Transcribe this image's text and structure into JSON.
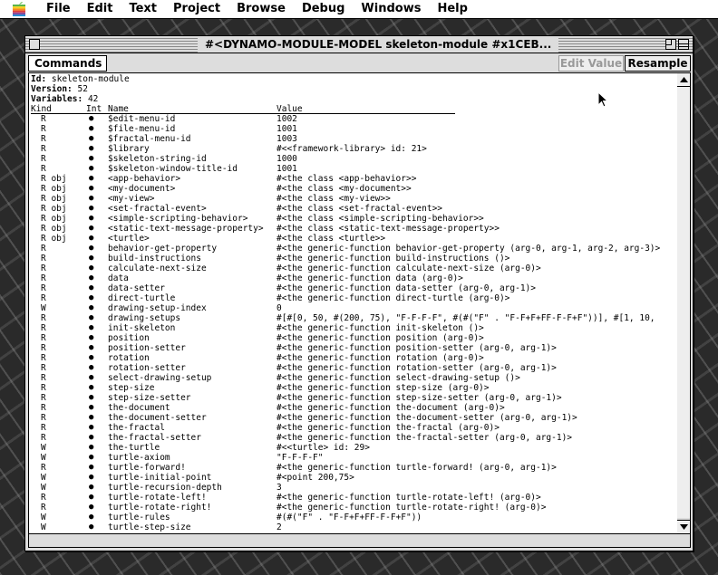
{
  "menubar": {
    "items": [
      "File",
      "Edit",
      "Text",
      "Project",
      "Browse",
      "Debug",
      "Windows",
      "Help"
    ]
  },
  "window": {
    "title": "#<DYNAMO-MODULE-MODEL skeleton-module #x1CEB..."
  },
  "toolbar": {
    "commands_label": "Commands",
    "edit_value_label": "Edit Value",
    "resample_label": "Resample"
  },
  "header": {
    "id_label": "Id:",
    "id_value": "skeleton-module",
    "version_label": "Version:",
    "version_value": "52",
    "variables_label": "Variables:",
    "variables_value": "42"
  },
  "columns": {
    "kind": "Kind",
    "int": "Int",
    "name": "Name",
    "value": "Value"
  },
  "rows": [
    {
      "kind": "R",
      "int": "●",
      "name": "$edit-menu-id",
      "value": "1002"
    },
    {
      "kind": "R",
      "int": "●",
      "name": "$file-menu-id",
      "value": "1001"
    },
    {
      "kind": "R",
      "int": "●",
      "name": "$fractal-menu-id",
      "value": "1003"
    },
    {
      "kind": "R",
      "int": "●",
      "name": "$library",
      "value": "#<<framework-library> id: 21>"
    },
    {
      "kind": "R",
      "int": "●",
      "name": "$skeleton-string-id",
      "value": "1000"
    },
    {
      "kind": "R",
      "int": "●",
      "name": "$skeleton-window-title-id",
      "value": "1001"
    },
    {
      "kind": "R obj",
      "int": "●",
      "name": "<app-behavior>",
      "value": "#<the class <app-behavior>>"
    },
    {
      "kind": "R obj",
      "int": "●",
      "name": "<my-document>",
      "value": "#<the class <my-document>>"
    },
    {
      "kind": "R obj",
      "int": "●",
      "name": "<my-view>",
      "value": "#<the class <my-view>>"
    },
    {
      "kind": "R obj",
      "int": "●",
      "name": "<set-fractal-event>",
      "value": "#<the class <set-fractal-event>>"
    },
    {
      "kind": "R obj",
      "int": "●",
      "name": "<simple-scripting-behavior>",
      "value": "#<the class <simple-scripting-behavior>>"
    },
    {
      "kind": "R obj",
      "int": "●",
      "name": "<static-text-message-property>",
      "value": "#<the class <static-text-message-property>>"
    },
    {
      "kind": "R obj",
      "int": "●",
      "name": "<turtle>",
      "value": "#<the class <turtle>>"
    },
    {
      "kind": "R",
      "int": "●",
      "name": "behavior-get-property",
      "value": "#<the generic-function behavior-get-property (arg-0, arg-1, arg-2, arg-3)>"
    },
    {
      "kind": "R",
      "int": "●",
      "name": "build-instructions",
      "value": "#<the generic-function build-instructions ()>"
    },
    {
      "kind": "R",
      "int": "●",
      "name": "calculate-next-size",
      "value": "#<the generic-function calculate-next-size (arg-0)>"
    },
    {
      "kind": "R",
      "int": "●",
      "name": "data",
      "value": "#<the generic-function data (arg-0)>"
    },
    {
      "kind": "R",
      "int": "●",
      "name": "data-setter",
      "value": "#<the generic-function data-setter (arg-0, arg-1)>"
    },
    {
      "kind": "R",
      "int": "●",
      "name": "direct-turtle",
      "value": "#<the generic-function direct-turtle (arg-0)>"
    },
    {
      "kind": "W",
      "int": "●",
      "name": "drawing-setup-index",
      "value": "0"
    },
    {
      "kind": "R",
      "int": "●",
      "name": "drawing-setups",
      "value": "#[#[0, 50, #(200, 75), \"F-F-F-F\", #(#(\"F\" . \"F-F+F+FF-F-F+F\"))], #[1, 10,"
    },
    {
      "kind": "R",
      "int": "●",
      "name": "init-skeleton",
      "value": "#<the generic-function init-skeleton ()>"
    },
    {
      "kind": "R",
      "int": "●",
      "name": "position",
      "value": "#<the generic-function position (arg-0)>"
    },
    {
      "kind": "R",
      "int": "●",
      "name": "position-setter",
      "value": "#<the generic-function position-setter (arg-0, arg-1)>"
    },
    {
      "kind": "R",
      "int": "●",
      "name": "rotation",
      "value": "#<the generic-function rotation (arg-0)>"
    },
    {
      "kind": "R",
      "int": "●",
      "name": "rotation-setter",
      "value": "#<the generic-function rotation-setter (arg-0, arg-1)>"
    },
    {
      "kind": "R",
      "int": "●",
      "name": "select-drawing-setup",
      "value": "#<the generic-function select-drawing-setup ()>"
    },
    {
      "kind": "R",
      "int": "●",
      "name": "step-size",
      "value": "#<the generic-function step-size (arg-0)>"
    },
    {
      "kind": "R",
      "int": "●",
      "name": "step-size-setter",
      "value": "#<the generic-function step-size-setter (arg-0, arg-1)>"
    },
    {
      "kind": "R",
      "int": "●",
      "name": "the-document",
      "value": "#<the generic-function the-document (arg-0)>"
    },
    {
      "kind": "R",
      "int": "●",
      "name": "the-document-setter",
      "value": "#<the generic-function the-document-setter (arg-0, arg-1)>"
    },
    {
      "kind": "R",
      "int": "●",
      "name": "the-fractal",
      "value": "#<the generic-function the-fractal (arg-0)>"
    },
    {
      "kind": "R",
      "int": "●",
      "name": "the-fractal-setter",
      "value": "#<the generic-function the-fractal-setter (arg-0, arg-1)>"
    },
    {
      "kind": "W",
      "int": "●",
      "name": "the-turtle",
      "value": "#<<turtle> id: 29>"
    },
    {
      "kind": "W",
      "int": "●",
      "name": "turtle-axiom",
      "value": "\"F-F-F-F\""
    },
    {
      "kind": "R",
      "int": "●",
      "name": "turtle-forward!",
      "value": "#<the generic-function turtle-forward! (arg-0, arg-1)>"
    },
    {
      "kind": "W",
      "int": "●",
      "name": "turtle-initial-point",
      "value": "#<point 200,75>"
    },
    {
      "kind": "W",
      "int": "●",
      "name": "turtle-recursion-depth",
      "value": "3"
    },
    {
      "kind": "R",
      "int": "●",
      "name": "turtle-rotate-left!",
      "value": "#<the generic-function turtle-rotate-left! (arg-0)>"
    },
    {
      "kind": "R",
      "int": "●",
      "name": "turtle-rotate-right!",
      "value": "#<the generic-function turtle-rotate-right! (arg-0)>"
    },
    {
      "kind": "W",
      "int": "●",
      "name": "turtle-rules",
      "value": "#(#(\"F\" . \"F-F+F+FF-F-F+F\"))"
    },
    {
      "kind": "W",
      "int": "●",
      "name": "turtle-step-size",
      "value": "2"
    }
  ],
  "icons": {
    "apple": "apple-logo-icon",
    "close": "close-box-icon",
    "zoom": "zoom-box-icon",
    "collapse": "collapse-box-icon",
    "scroll_up": "scroll-up-arrow-icon",
    "scroll_down": "scroll-down-arrow-icon",
    "cursor": "mouse-pointer-icon"
  }
}
